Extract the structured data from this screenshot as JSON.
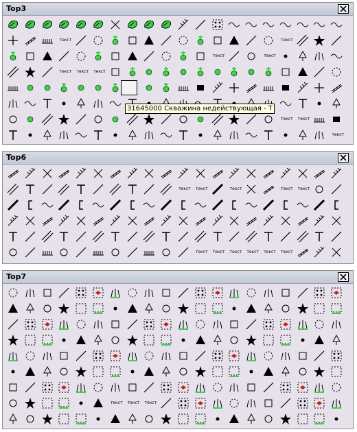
{
  "panels": [
    {
      "title": "Top3"
    },
    {
      "title": "Top6"
    },
    {
      "title": "Top7"
    }
  ],
  "tooltip": {
    "text": "31645000 Скважина недействующая - Т"
  },
  "labels": {
    "tekst": "текст"
  },
  "colors": {
    "panel_bg": "#e6e1ea",
    "accent_green": "#3bd34a",
    "accent_red": "#c41e1e",
    "highlight_cyan": "#2ee8d6"
  },
  "icons": [
    "close-icon",
    "map-symbol-icon",
    "well-icon",
    "tree-icon",
    "swamp-icon",
    "arrow-icon"
  ]
}
